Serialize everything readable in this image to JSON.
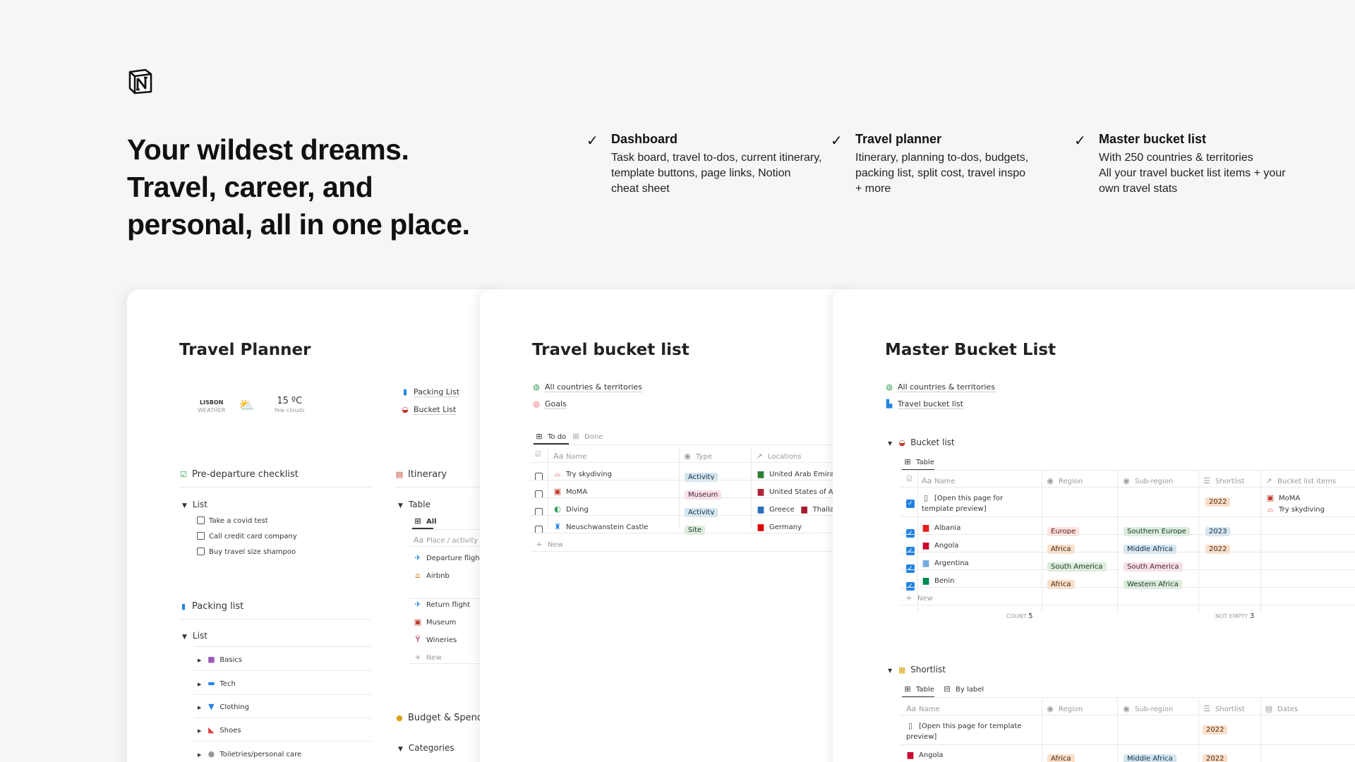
{
  "hero": {
    "headline_line1": "Your wildest dreams.",
    "headline_line2": "Travel, career, and",
    "headline_line3": "personal, all in one place."
  },
  "features": [
    {
      "title": "Dashboard",
      "desc": "Task board, travel to-dos, current itinerary,\ntemplate buttons, page links, Notion\ncheat sheet"
    },
    {
      "title": "Travel planner",
      "desc": "Itinerary, planning to-dos, budgets,\npacking list, split cost, travel inspo\n+ more"
    },
    {
      "title": "Master bucket list",
      "desc": "With 250 countries & territories\nAll your travel bucket list items + your\nown travel stats"
    }
  ],
  "planner": {
    "title": "Travel Planner",
    "weather_city": "LISBON",
    "weather_label": "WEATHER",
    "weather_temp": "15 ºC",
    "weather_desc": "few clouds",
    "links": [
      "Packing List",
      "Bucket List"
    ],
    "checklist_title": "Pre-departure checklist",
    "list_label": "List",
    "checklist_items": [
      "Take a covid test",
      "Call credit card company",
      "Buy travel size shampoo"
    ],
    "packing_title": "Packing list",
    "packing_list_label": "List",
    "packing_items": [
      "Basics",
      "Tech",
      "Clothing",
      "Shoes",
      "Toiletries/personal care"
    ],
    "itinerary_title": "Itinerary",
    "table_label": "Table",
    "view_all": "All",
    "col_place": "Place / activity",
    "itinerary_items": [
      "Departure flight",
      "Airbnb",
      "Return flight",
      "Museum",
      "Wineries"
    ],
    "new_label": "New",
    "budget_title": "Budget & Spendi",
    "categories_label": "Categories"
  },
  "bucket": {
    "title": "Travel bucket list",
    "links": [
      "All countries & territories",
      "Goals"
    ],
    "tab_todo": "To do",
    "tab_done": "Done",
    "columns": [
      "Name",
      "Type",
      "Locations"
    ],
    "rows": [
      {
        "name": "Try skydiving",
        "type": "Activity",
        "loc": "United Arab Emirat",
        "loc2": ""
      },
      {
        "name": "MoMA",
        "type": "Museum",
        "loc": "United States of Ar",
        "loc2": ""
      },
      {
        "name": "Diving",
        "type": "Activity",
        "loc": "Greece",
        "loc2": "Thailar"
      },
      {
        "name": "Neuschwanstein Castle",
        "type": "Site",
        "loc": "Germany",
        "loc2": ""
      }
    ],
    "new_label": "New"
  },
  "master": {
    "title": "Master Bucket List",
    "links": [
      "All countries & territories",
      "Travel bucket list"
    ],
    "bucket_section": "Bucket list",
    "table_label": "Table",
    "columns": [
      "Name",
      "Region",
      "Sub-region",
      "Shortlist",
      "Bucket list items"
    ],
    "rows": [
      {
        "name1": "[Open this page for",
        "name2": "template preview]",
        "region": "",
        "sub": "",
        "short": "2022",
        "items1": "MoMA",
        "items2": "Try skydiving"
      },
      {
        "name1": "Albania",
        "name2": "",
        "region": "Europe",
        "sub": "Southern Europe",
        "short": "2023",
        "items1": "",
        "items2": ""
      },
      {
        "name1": "Angola",
        "name2": "",
        "region": "Africa",
        "sub": "Middle Africa",
        "short": "2022",
        "items1": "",
        "items2": ""
      },
      {
        "name1": "Argentina",
        "name2": "",
        "region": "South America",
        "sub": "South America",
        "short": "",
        "items1": "",
        "items2": ""
      },
      {
        "name1": "Benin",
        "name2": "",
        "region": "Africa",
        "sub": "Western Africa",
        "short": "",
        "items1": "",
        "items2": ""
      }
    ],
    "new_label": "New",
    "count_label": "COUNT",
    "count_value": "5",
    "notempty_label": "NOT EMPTY",
    "notempty_value": "3",
    "shortlist_section": "Shortlist",
    "sl_tab_table": "Table",
    "sl_tab_label": "By label",
    "sl_columns": [
      "Name",
      "Region",
      "Sub-region",
      "Shortlist",
      "Dates"
    ],
    "sl_rows": [
      {
        "name1": "[Open this page for template",
        "name2": "preview]",
        "region": "",
        "sub": "",
        "short": "2022"
      },
      {
        "name1": "Angola",
        "name2": "",
        "region": "Africa",
        "sub": "Middle Africa",
        "short": "2022"
      }
    ]
  }
}
